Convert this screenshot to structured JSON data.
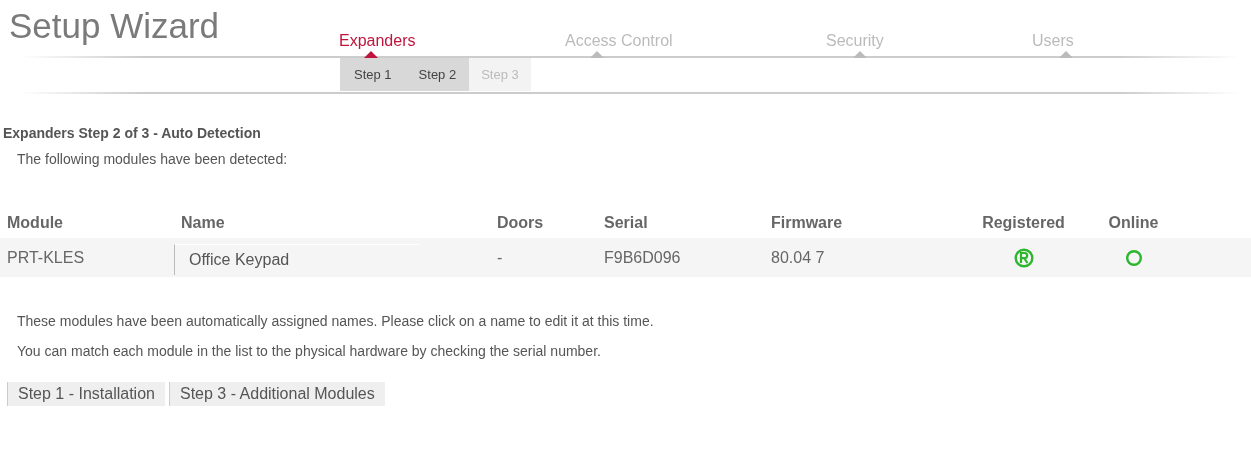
{
  "title": "Setup Wizard",
  "tabs": [
    {
      "label": "Expanders",
      "selected": true
    },
    {
      "label": "Access Control",
      "selected": false
    },
    {
      "label": "Security",
      "selected": false
    },
    {
      "label": "Users",
      "selected": false
    }
  ],
  "steps": [
    {
      "label": "Step 1",
      "disabled": false
    },
    {
      "label": "Step 2",
      "disabled": false
    },
    {
      "label": "Step 3",
      "disabled": true
    }
  ],
  "heading": "Expanders Step 2 of 3 - Auto Detection",
  "intro": "The following modules have been detected:",
  "table": {
    "columns": [
      "Module",
      "Name",
      "Doors",
      "Serial",
      "Firmware",
      "Registered",
      "Online"
    ],
    "rows": [
      {
        "module": "PRT-KLES",
        "name": "Office Keypad",
        "doors": "-",
        "serial": "F9B6D096",
        "firmware": "80.04 7",
        "registered": true,
        "online": true
      }
    ]
  },
  "notes": [
    "These modules have been automatically assigned names. Please click on a name to edit it at this time.",
    "You can match each module in the list to the physical hardware by checking the serial number."
  ],
  "buttons": [
    "Step 1 - Installation",
    "Step 3 - Additional Modules"
  ]
}
